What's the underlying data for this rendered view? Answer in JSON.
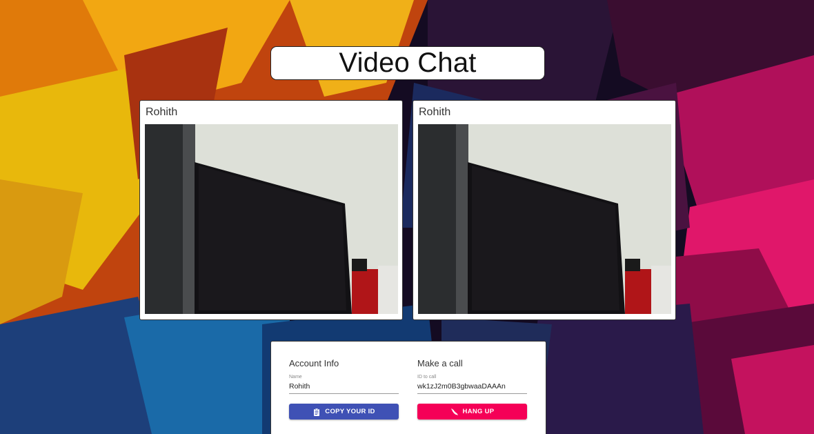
{
  "header": {
    "title": "Video Chat"
  },
  "videos": [
    {
      "name": "Rohith"
    },
    {
      "name": "Rohith"
    }
  ],
  "account": {
    "heading": "Account Info",
    "name_label": "Name",
    "name_value": "Rohith",
    "copy_button": "COPY YOUR ID"
  },
  "call": {
    "heading": "Make a call",
    "id_label": "ID to call",
    "id_value": "wk1zJ2m0B3gbwaaDAAAn",
    "hangup_button": "HANG UP"
  },
  "colors": {
    "primary": "#3f51b5",
    "secondary": "#f50057"
  },
  "icons": {
    "copy": "clipboard-icon",
    "hangup": "phone-hangup-icon"
  }
}
